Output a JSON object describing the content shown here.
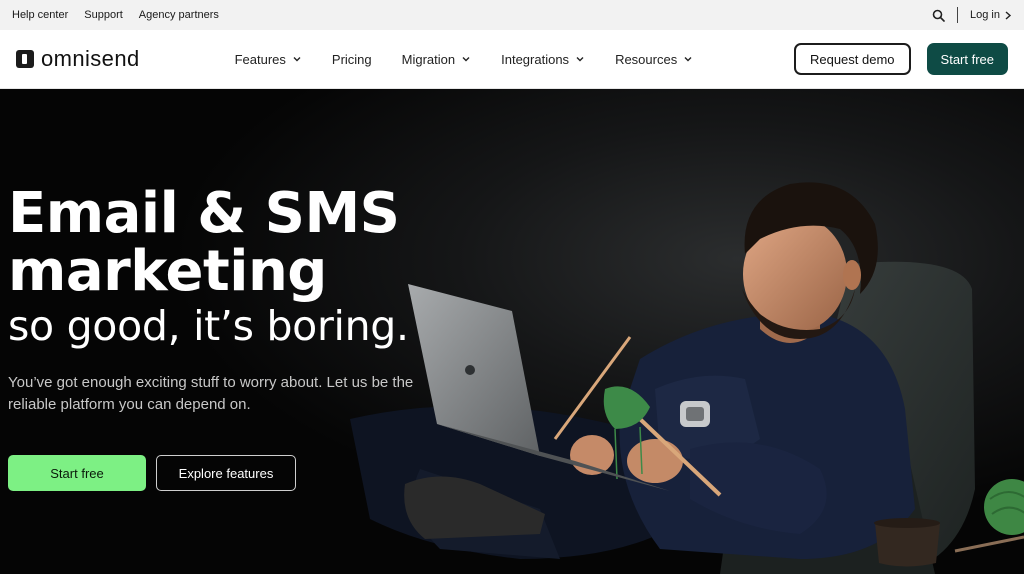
{
  "utility": {
    "links": [
      "Help center",
      "Support",
      "Agency partners"
    ],
    "login_label": "Log in"
  },
  "nav": {
    "logo_text": "omnisend",
    "items": [
      {
        "label": "Features",
        "has_dropdown": true
      },
      {
        "label": "Pricing",
        "has_dropdown": false
      },
      {
        "label": "Migration",
        "has_dropdown": true
      },
      {
        "label": "Integrations",
        "has_dropdown": true
      },
      {
        "label": "Resources",
        "has_dropdown": true
      }
    ],
    "request_demo": "Request demo",
    "start_free": "Start free"
  },
  "hero": {
    "headline_line1": "Email & SMS",
    "headline_line2": "marketing",
    "subheadline": "so good, it’s boring.",
    "description": "You’ve got enough exciting stuff to worry about. Let us be the reliable platform you can depend on.",
    "cta_primary": "Start free",
    "cta_secondary": "Explore features"
  },
  "colors": {
    "accent_dark_green": "#0e4b45",
    "accent_light_green": "#7df084",
    "utility_bg": "#f2f2f2",
    "hero_bg": "#050505"
  },
  "icons": {
    "search": "search-icon",
    "chevron": "chevron-down-icon",
    "login_chevron": "chevron-right-icon",
    "logo": "omnisend-logo-icon"
  }
}
